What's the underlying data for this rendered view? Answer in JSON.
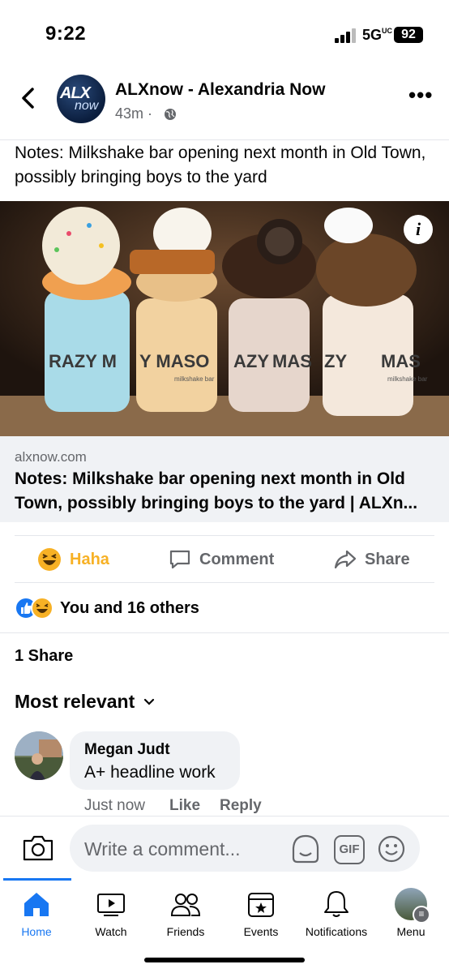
{
  "status_bar": {
    "time": "9:22",
    "network": "5G",
    "network_sup": "UC",
    "battery": "92"
  },
  "header": {
    "page_name": "ALXnow - Alexandria Now",
    "time_ago": "43m ·",
    "avatar_text_1": "ALX",
    "avatar_text_2": "now"
  },
  "post": {
    "caption": "Notes: Milkshake bar opening next month in Old Town, possibly bringing boys to the yard",
    "jar_labels": [
      "RAZY M",
      "Y MASO",
      "AZY",
      "MAS",
      "ZY",
      "MAS"
    ],
    "jar_sublabel": "milkshake bar"
  },
  "link_preview": {
    "domain": "alxnow.com",
    "title": "Notes: Milkshake bar opening next month in Old Town, possibly bringing boys to the yard | ALXn..."
  },
  "actions": {
    "haha": "Haha",
    "comment": "Comment",
    "share": "Share"
  },
  "reactions": {
    "summary": "You and 16 others"
  },
  "shares": "1 Share",
  "sort": {
    "label": "Most relevant"
  },
  "comment": {
    "author": "Megan Judt",
    "text": "A+ headline work",
    "time": "Just now",
    "like": "Like",
    "reply": "Reply"
  },
  "composer": {
    "placeholder": "Write a comment...",
    "gif": "GIF"
  },
  "tabs": [
    {
      "label": "Home",
      "icon": "home-icon"
    },
    {
      "label": "Watch",
      "icon": "watch-icon"
    },
    {
      "label": "Friends",
      "icon": "friends-icon"
    },
    {
      "label": "Events",
      "icon": "events-icon"
    },
    {
      "label": "Notifications",
      "icon": "bell-icon"
    },
    {
      "label": "Menu",
      "icon": "menu-avatar-icon"
    }
  ],
  "colors": {
    "accent": "#1877f2",
    "haha": "#f7b125",
    "secondary_text": "#65676b",
    "surface": "#f0f2f5"
  }
}
